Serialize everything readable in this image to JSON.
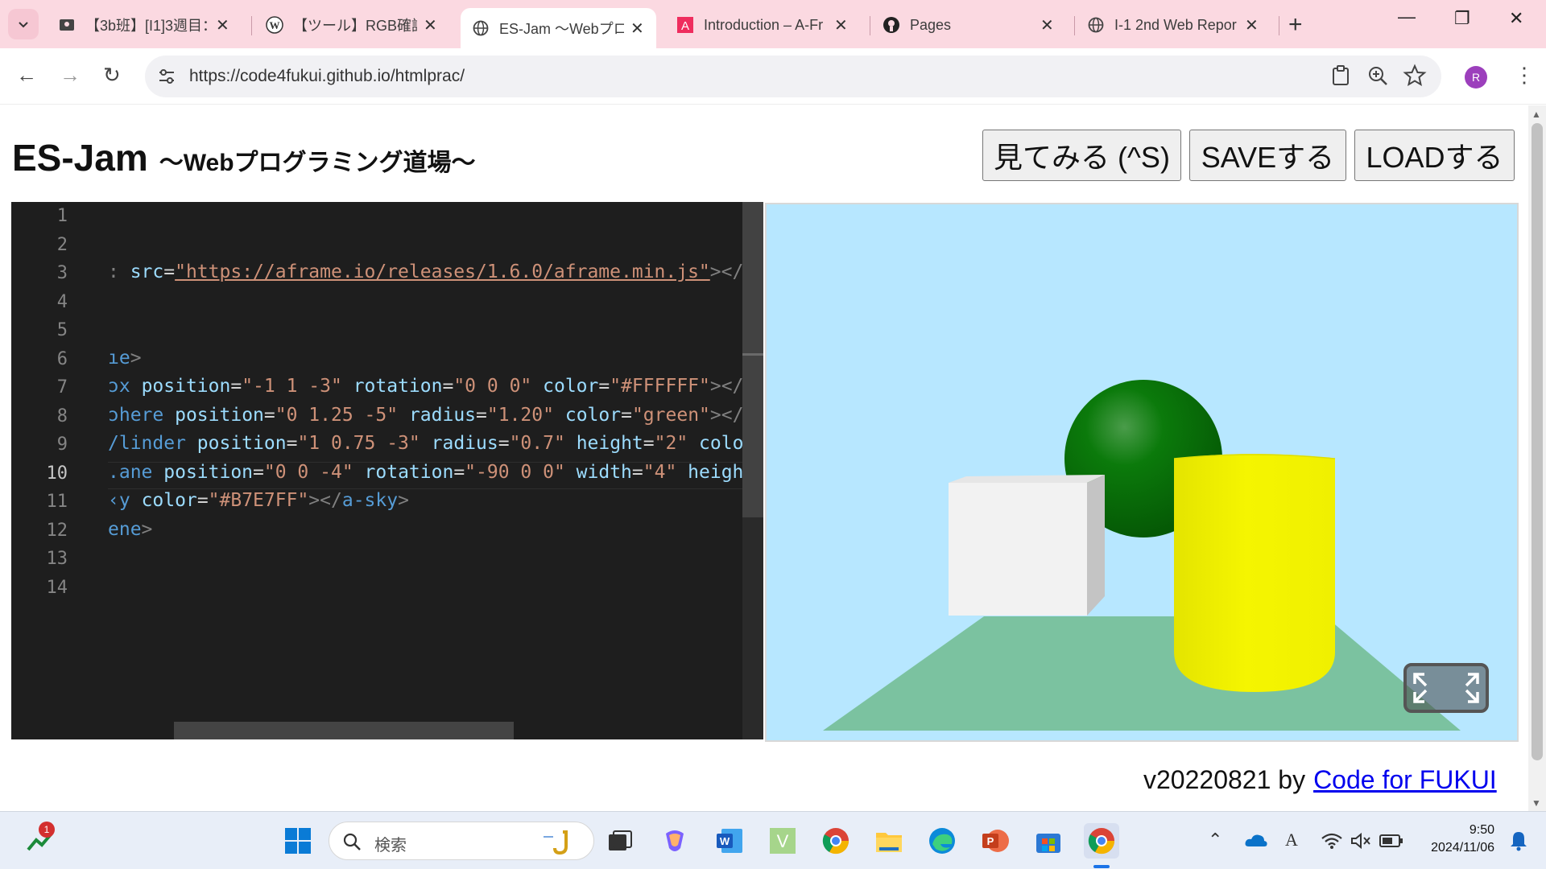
{
  "browser": {
    "tabs": [
      {
        "title": "【3b班】[I1]3週目："
      },
      {
        "title": "【ツール】RGB確認ツー"
      },
      {
        "title": "ES-Jam 〜Webプロ"
      },
      {
        "title": "Introduction – A-Fr"
      },
      {
        "title": "Pages"
      },
      {
        "title": "I-1 2nd Web Repor"
      }
    ],
    "url": "https://code4fukui.github.io/htmlprac/",
    "avatar_letter": "R"
  },
  "page": {
    "title": "ES-Jam",
    "subtitle": "〜Webプログラミング道場〜",
    "buttons": {
      "view": "見てみる (^S)",
      "save": "SAVEする",
      "load": "LOADする"
    },
    "footer_version": "v20220821 by",
    "footer_link": "Code for FUKUI"
  },
  "editor": {
    "line_numbers": [
      "1",
      "2",
      "3",
      "4",
      "5",
      "6",
      "7",
      "8",
      "9",
      "10",
      "11",
      "12",
      "13",
      "14"
    ],
    "current_line": "10",
    "code": {
      "l3_pre": ": ",
      "l3_attr": "src",
      "l3_url": "\"https://aframe.io/releases/1.6.0/aframe.min.js\"",
      "l3_post": "></",
      "l6_tag": "ıe",
      "l7_tag": "ɔx",
      "l7_rest": [
        {
          "a": "position",
          "v": "\"-1 1 -3\""
        },
        {
          "a": "rotation",
          "v": "\"0 0 0\""
        },
        {
          "a": "color",
          "v": "\"#FFFFFF\""
        }
      ],
      "l8_tag": "ɔhere",
      "l8_rest": [
        {
          "a": "position",
          "v": "\"0 1.25 -5\""
        },
        {
          "a": "radius",
          "v": "\"1.20\""
        },
        {
          "a": "color",
          "v": "\"green\""
        }
      ],
      "l9_tag": "/linder",
      "l9_rest": [
        {
          "a": "position",
          "v": "\"1 0.75 -3\""
        },
        {
          "a": "radius",
          "v": "\"0.7\""
        },
        {
          "a": "height",
          "v": "\"2\""
        },
        {
          "a": "colo",
          "v": ""
        }
      ],
      "l10_tag": ".ane",
      "l10_rest": [
        {
          "a": "position",
          "v": "\"0 0 -4\""
        },
        {
          "a": "rotation",
          "v": "\"-90 0 0\""
        },
        {
          "a": "width",
          "v": "\"4\""
        },
        {
          "a": "heigh",
          "v": ""
        }
      ],
      "l11_tag": "‹y",
      "l11_attr": "color",
      "l11_val": "\"#B7E7FF\"",
      "l11_close": "a-sky",
      "l12_tag": "ene"
    }
  },
  "preview": {
    "sky_color": "#B7E7FF",
    "box_color": "#FFFFFF",
    "sphere_color": "green",
    "cylinder_color": "yellow",
    "plane_color": "#7BC2A0"
  },
  "taskbar": {
    "search_label": "検索",
    "time": "9:50",
    "date": "2024/11/06",
    "notification_count": "1"
  }
}
